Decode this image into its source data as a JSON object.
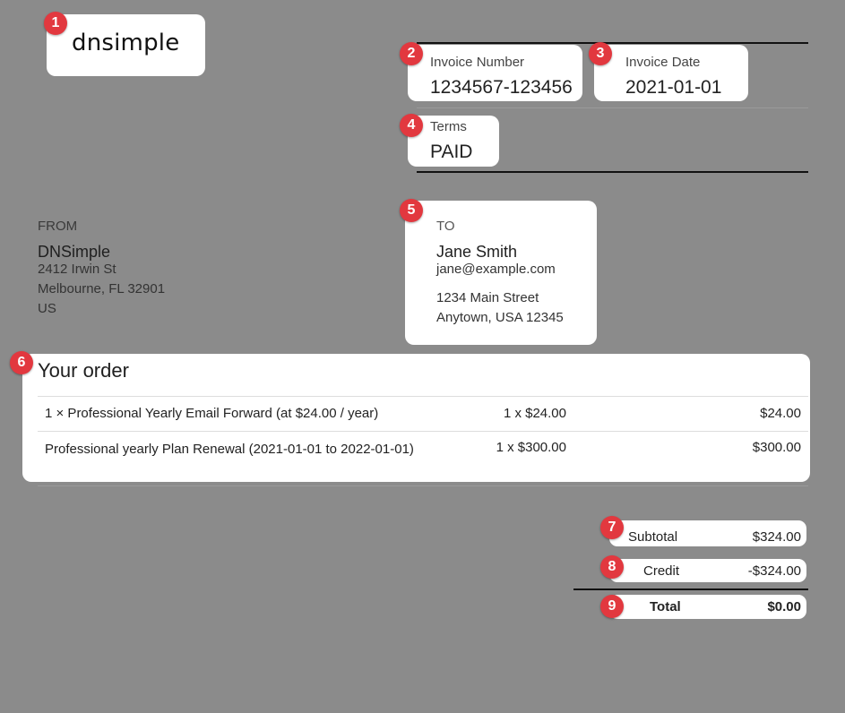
{
  "logo": {
    "text": "dnsimple"
  },
  "invoice": {
    "number_label": "Invoice Number",
    "number_value": "1234567-123456",
    "date_label": "Invoice Date",
    "date_value": "2021-01-01",
    "terms_label": "Terms",
    "terms_value": "PAID"
  },
  "from": {
    "heading": "FROM",
    "name": "DNSimple",
    "street": "2412 Irwin St",
    "city": "Melbourne, FL 32901",
    "country": "US"
  },
  "to": {
    "heading": "TO",
    "name": "Jane Smith",
    "email": "jane@example.com",
    "street": "1234 Main Street",
    "city": "Anytown, USA 12345"
  },
  "order": {
    "title": "Your order",
    "rows": [
      {
        "description": "1 × Professional Yearly Email Forward (at $24.00 / year)",
        "quantity": "1 x $24.00",
        "amount": "$24.00"
      },
      {
        "description": "Professional yearly Plan Renewal (2021-01-01 to 2022-01-01)",
        "quantity": "1 x $300.00",
        "amount": "$300.00"
      }
    ]
  },
  "totals": {
    "subtotal_label": "Subtotal",
    "subtotal_value": "$324.00",
    "credit_label": "Credit",
    "credit_value": "-$324.00",
    "total_label": "Total",
    "total_value": "$0.00"
  },
  "badges": [
    "1",
    "2",
    "3",
    "4",
    "5",
    "6",
    "7",
    "8",
    "9"
  ],
  "colors": {
    "background": "#8b8b8b",
    "card": "#ffffff",
    "badge": "#e2383f"
  }
}
